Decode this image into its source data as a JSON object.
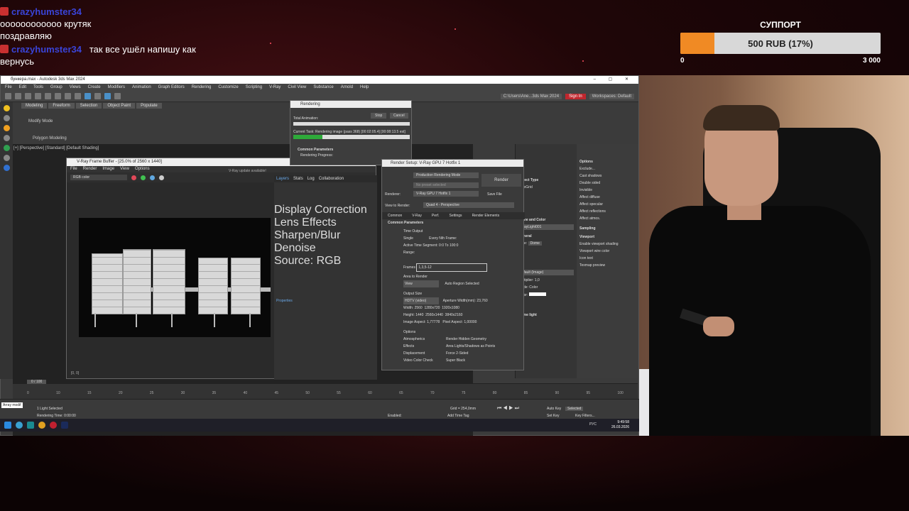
{
  "chat": [
    {
      "user": "crazyhumster34",
      "text": "оооооооооооо крутяк поздравляю"
    },
    {
      "user": "crazyhumster34",
      "text": "так все ушёл напишу как вернусь"
    }
  ],
  "donation": {
    "title": "СУППОРТ",
    "label": "500 RUB (17%)",
    "progress_percent": 17,
    "min": "0",
    "max": "3 000",
    "fill_color": "#f08a24"
  },
  "max": {
    "title": "бункера.max - Autodesk 3ds Max 2024",
    "menu": [
      "File",
      "Edit",
      "Tools",
      "Group",
      "Views",
      "Create",
      "Modifiers",
      "Animation",
      "Graph Editors",
      "Rendering",
      "Customize",
      "Scripting",
      "V-Ray",
      "Civil View",
      "Substance",
      "Arnold",
      "Help"
    ],
    "tabs": [
      "Modeling",
      "Freeform",
      "Selection",
      "Object Paint",
      "Populate"
    ],
    "viewport_label": "[+] [Perspective] [Standard] [Default Shading]",
    "sign_in": "Sign In",
    "workspace": "Workspaces: Default",
    "path": "C:\\Users\\Ane...3ds Max 2024",
    "modify_mode": "Modify Mode",
    "poly_modeling": "Polygon Modeling"
  },
  "vfb": {
    "title": "V-Ray Frame Buffer - [25.0% of 2560 x 1440]",
    "update": "V-Ray update available!",
    "menu": [
      "File",
      "Render",
      "Image",
      "View",
      "Options"
    ],
    "channel": "RGB color",
    "layer_tabs": [
      "Layers",
      "Stats",
      "Log",
      "Collaboration"
    ],
    "layers": [
      "Display Correction",
      "Lens Effects",
      "Sharpen/Blur",
      "Denoise",
      "Source: RGB"
    ],
    "properties": "Properties",
    "coords": "[0, 0]"
  },
  "rendering": {
    "title": "Rendering",
    "stop": "Stop",
    "cancel": "Cancel",
    "total": "Total Animation:",
    "task": "Current Task:  Rendering image (pass 368) [00:02:05.4] [00:08:13.5 est]",
    "params": "Common Parameters",
    "progress_label": "Rendering Progress:",
    "progress": 0.25
  },
  "render_setup": {
    "title": "Render Setup: V-Ray GPU 7 Hotfix 1",
    "target": "Production Rendering Mode",
    "preset": "No preset selected",
    "renderer": "V-Ray GPU 7 Hotfix 1",
    "view": "Quad 4 - Perspective",
    "render_btn": "Render",
    "save_file": "Save File",
    "tabs": [
      "Common",
      "V-Ray",
      "Perf.",
      "Settings",
      "Render Elements"
    ],
    "section": "Common Parameters",
    "time_output": "Time Output",
    "single": "Single",
    "every_nth": "Every Nth Frame:",
    "active_segment": "Active Time Segment:",
    "segment_value": "0:0 To 100:0",
    "range": "Range:",
    "frames": "Frames",
    "frames_value": "1,3,5-12",
    "area": "Area to Render",
    "area_value": "View",
    "auto_region": "Auto Region Selected",
    "output_size": "Output Size",
    "size_preset": "HDTV (video)",
    "aperture": "Aperture Width(mm): 23,760",
    "width_label": "Width:",
    "width_value": "2560",
    "height_label": "Height:",
    "height_value": "1440",
    "image_aspect": "Image Aspect: 1,77778",
    "pixel_aspect": "Pixel Aspect:",
    "pixel_value": "1,00000",
    "presets": [
      "1280x720",
      "1920x1080",
      "2560x1440",
      "3840x2160"
    ],
    "options": "Options",
    "opts": [
      "Atmospherics",
      "Render Hidden Geometry",
      "Effects",
      "Area Lights/Shadows as Points",
      "Displacement",
      "Force 2-Sided",
      "Video Color Check",
      "Super Black"
    ]
  },
  "command_panel": {
    "options": "Options",
    "items": [
      "Exclude...",
      "Cast shadows",
      "Double sided",
      "Invisible",
      "Affect diffuse",
      "Affect specular",
      "Affect reflections",
      "Affect atmos."
    ],
    "values": [
      "1,0",
      "1,0",
      "1,0",
      "1,0"
    ],
    "sampling": "Sampling",
    "viewport": "Viewport",
    "vp_items": [
      "Enable viewport shading",
      "Viewport wire color",
      "Icon text",
      "Texmap preview"
    ],
    "object_type": "Object Type",
    "autogrid": "AutoGrid",
    "name_color": "Name and Color",
    "light_name": "VRayLight001",
    "general": "General",
    "type": "Type:",
    "type_val": "Dome",
    "multiplier": "Multiplier:",
    "mult_val": "1,0",
    "mode": "Mode:",
    "mode_val": "Color",
    "color": "Color:",
    "dome_light": "Dome light",
    "default_image": "Default (Image)"
  },
  "timeline": {
    "frame": "0 / 100",
    "ticks": [
      "0",
      "10",
      "15",
      "20",
      "25",
      "30",
      "35",
      "40",
      "45",
      "50",
      "55",
      "60",
      "65",
      "70",
      "75",
      "80",
      "85",
      "90",
      "95",
      "100"
    ]
  },
  "status": {
    "selected": "1 Light Selected",
    "render_time": "Rendering Time: 0:00:00",
    "grid": "Grid = 254,0mm",
    "auto_key": "Auto Key",
    "set_key": "Set Key",
    "selected_dd": "Selected",
    "key_filters": "Key Filters...",
    "add_time_tag": "Add Time Tag",
    "enabled": "Enabled:",
    "maxscript": "Array modif"
  },
  "taskbar": {
    "time": "9:49:58",
    "date": "26.03.2026",
    "lang": "РУС"
  }
}
